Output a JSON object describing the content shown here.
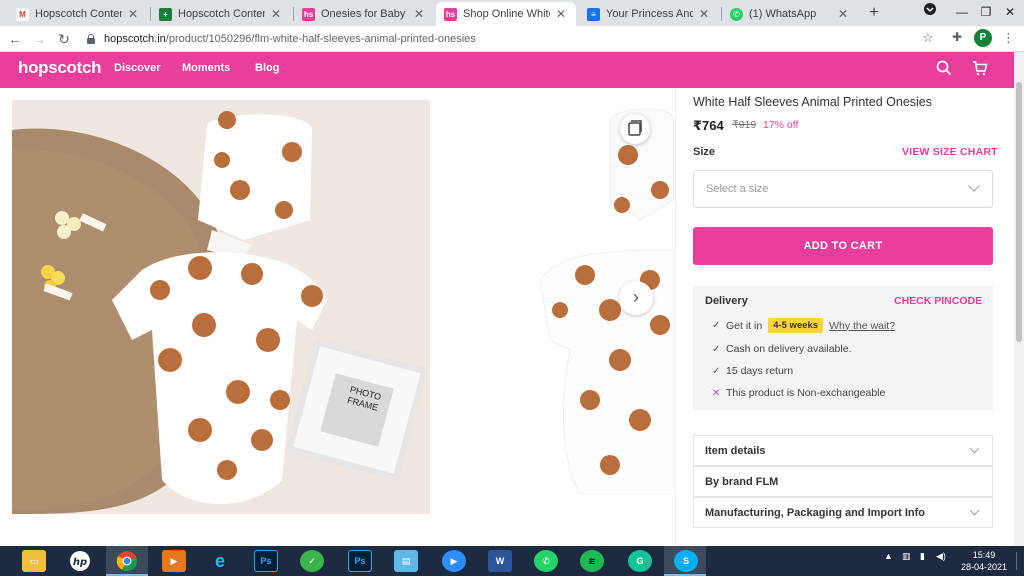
{
  "browser": {
    "tabs": [
      {
        "title": "Hopscotch Content - In",
        "icon": "gmail-icon",
        "color": "#d93025",
        "glyph": "M",
        "active": false
      },
      {
        "title": "Hopscotch Content Ma",
        "icon": "sheets-icon",
        "color": "#188038",
        "glyph": "+",
        "active": false
      },
      {
        "title": "Onesies for Baby Girl | H",
        "icon": "hopscotch-icon",
        "color": "#e83e9c",
        "glyph": "hs",
        "active": false
      },
      {
        "title": "Shop Online White Half",
        "icon": "hopscotch-icon",
        "color": "#e83e9c",
        "glyph": "hs",
        "active": true
      },
      {
        "title": "Your Princess And Her",
        "icon": "docs-icon",
        "color": "#1a73e8",
        "glyph": "≡",
        "active": false
      },
      {
        "title": "(1) WhatsApp",
        "icon": "whatsapp-icon",
        "color": "#25d366",
        "glyph": "✆",
        "active": false
      }
    ],
    "url_domain": "hopscotch.in",
    "url_path": "/product/1050296/flm-white-half-sleeves-animal-printed-onesies",
    "profile_initial": "P"
  },
  "site": {
    "logo": "hopscotch",
    "nav": [
      "Discover",
      "Moments",
      "Blog"
    ],
    "brand_color": "#e83e9c"
  },
  "product": {
    "title": "White Half Sleeves Animal Printed Onesies",
    "price": "₹764",
    "mrp": "₹919",
    "discount": "17% off",
    "size_label": "Size",
    "size_chart": "VIEW SIZE CHART",
    "size_placeholder": "Select a size",
    "add_to_cart": "ADD TO CART",
    "photo_frame_text": "PHOTO FRAME"
  },
  "delivery": {
    "title": "Delivery",
    "check_pincode": "CHECK PINCODE",
    "get_it_in": "Get it in",
    "eta": "4-5 weeks",
    "why_wait": "Why the wait?",
    "cod": "Cash on delivery available.",
    "returns": "15 days return",
    "exchange": "This product is Non-exchangeable"
  },
  "accordions": {
    "item_details": "Item details",
    "brand": "By brand FLM",
    "manufacturing": "Manufacturing, Packaging and Import Info"
  },
  "taskbar": {
    "time": "15:49",
    "date": "28-04-2021"
  }
}
